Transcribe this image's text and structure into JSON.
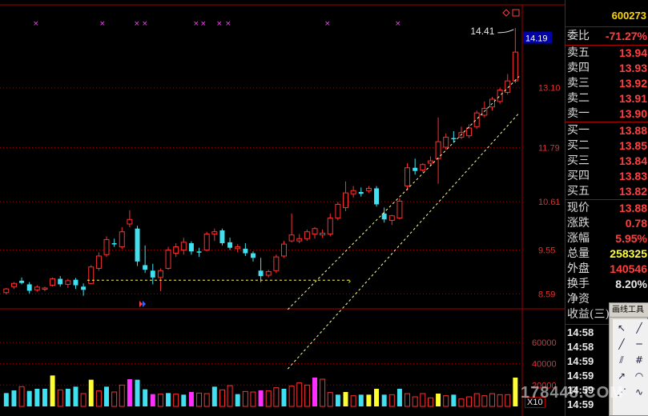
{
  "stock": {
    "code": "600273"
  },
  "price_axis": {
    "labels": [
      "14.19",
      "13.10",
      "11.79",
      "10.61",
      "9.55",
      "8.59"
    ],
    "current": "14.19"
  },
  "volume_axis": {
    "labels": [
      "60000",
      "40000",
      "20000"
    ],
    "multiplier": "X10"
  },
  "annotations": {
    "high_label": "14.41"
  },
  "quote": {
    "weibi": {
      "label": "委比",
      "value": "-71.27%"
    },
    "asks": [
      {
        "label": "卖五",
        "price": "13.94"
      },
      {
        "label": "卖四",
        "price": "13.93"
      },
      {
        "label": "卖三",
        "price": "13.92"
      },
      {
        "label": "卖二",
        "price": "13.91"
      },
      {
        "label": "卖一",
        "price": "13.90"
      }
    ],
    "bids": [
      {
        "label": "买一",
        "price": "13.88"
      },
      {
        "label": "买二",
        "price": "13.85"
      },
      {
        "label": "买三",
        "price": "13.84"
      },
      {
        "label": "买四",
        "price": "13.83"
      },
      {
        "label": "买五",
        "price": "13.82"
      }
    ],
    "stats": [
      {
        "label": "现价",
        "value": "13.88"
      },
      {
        "label": "涨跌",
        "value": "0.78"
      },
      {
        "label": "涨幅",
        "value": "5.95%"
      },
      {
        "label": "总量",
        "value": "258325"
      },
      {
        "label": "外盘",
        "value": "140546"
      },
      {
        "label": "换手",
        "value": "8.20%"
      },
      {
        "label": "净资",
        "value": ""
      },
      {
        "label": "收益(三)",
        "value": ""
      }
    ],
    "ticks": [
      "14:58",
      "14:58",
      "14:59",
      "14:59",
      "14:59",
      "14:59"
    ]
  },
  "drawing_tools": {
    "title": "画线工具"
  },
  "watermark": "178448.COM",
  "colors": {
    "up": "#ff3030",
    "down": "#40e0f0",
    "yellow": "#ffff30",
    "magenta": "#ff30ff",
    "grid": "#a00000"
  },
  "chart_data": {
    "type": "candlestick",
    "title": "",
    "ylim": [
      8.3,
      14.6
    ],
    "candles": [
      {
        "o": 8.62,
        "h": 8.72,
        "l": 8.58,
        "c": 8.7
      },
      {
        "o": 8.75,
        "h": 8.85,
        "l": 8.7,
        "c": 8.82
      },
      {
        "o": 8.88,
        "h": 8.95,
        "l": 8.8,
        "c": 8.83
      },
      {
        "o": 8.8,
        "h": 8.85,
        "l": 8.6,
        "c": 8.66
      },
      {
        "o": 8.68,
        "h": 8.78,
        "l": 8.64,
        "c": 8.74
      },
      {
        "o": 8.7,
        "h": 8.75,
        "l": 8.65,
        "c": 8.72
      },
      {
        "o": 8.78,
        "h": 8.95,
        "l": 8.75,
        "c": 8.92
      },
      {
        "o": 8.92,
        "h": 8.98,
        "l": 8.75,
        "c": 8.8
      },
      {
        "o": 8.8,
        "h": 8.92,
        "l": 8.72,
        "c": 8.88
      },
      {
        "o": 8.9,
        "h": 8.94,
        "l": 8.7,
        "c": 8.78
      },
      {
        "o": 8.75,
        "h": 8.82,
        "l": 8.55,
        "c": 8.68
      },
      {
        "o": 8.82,
        "h": 9.22,
        "l": 8.8,
        "c": 9.18
      },
      {
        "o": 9.15,
        "h": 9.5,
        "l": 9.1,
        "c": 9.42
      },
      {
        "o": 9.45,
        "h": 9.85,
        "l": 9.4,
        "c": 9.78
      },
      {
        "o": 9.7,
        "h": 9.8,
        "l": 9.62,
        "c": 9.68
      },
      {
        "o": 9.62,
        "h": 10.05,
        "l": 9.58,
        "c": 9.95
      },
      {
        "o": 10.12,
        "h": 10.42,
        "l": 10.05,
        "c": 10.22
      },
      {
        "o": 10.02,
        "h": 10.08,
        "l": 9.2,
        "c": 9.3
      },
      {
        "o": 9.22,
        "h": 9.65,
        "l": 9.05,
        "c": 9.12
      },
      {
        "o": 9.1,
        "h": 9.25,
        "l": 8.8,
        "c": 8.95
      },
      {
        "o": 8.95,
        "h": 9.15,
        "l": 8.65,
        "c": 9.1
      },
      {
        "o": 9.15,
        "h": 9.62,
        "l": 9.12,
        "c": 9.55
      },
      {
        "o": 9.48,
        "h": 9.7,
        "l": 9.4,
        "c": 9.62
      },
      {
        "o": 9.55,
        "h": 9.82,
        "l": 9.45,
        "c": 9.72
      },
      {
        "o": 9.7,
        "h": 9.74,
        "l": 9.45,
        "c": 9.52
      },
      {
        "o": 9.52,
        "h": 9.6,
        "l": 9.4,
        "c": 9.5
      },
      {
        "o": 9.55,
        "h": 9.95,
        "l": 9.52,
        "c": 9.9
      },
      {
        "o": 9.9,
        "h": 10.02,
        "l": 9.75,
        "c": 9.95
      },
      {
        "o": 9.98,
        "h": 10.02,
        "l": 9.65,
        "c": 9.7
      },
      {
        "o": 9.72,
        "h": 9.82,
        "l": 9.55,
        "c": 9.6
      },
      {
        "o": 9.58,
        "h": 9.68,
        "l": 9.5,
        "c": 9.62
      },
      {
        "o": 9.58,
        "h": 9.7,
        "l": 9.42,
        "c": 9.48
      },
      {
        "o": 9.48,
        "h": 9.52,
        "l": 9.3,
        "c": 9.38
      },
      {
        "o": 9.1,
        "h": 9.38,
        "l": 8.85,
        "c": 8.98
      },
      {
        "o": 9.0,
        "h": 9.12,
        "l": 8.95,
        "c": 9.08
      },
      {
        "o": 9.1,
        "h": 9.45,
        "l": 9.05,
        "c": 9.4
      },
      {
        "o": 9.42,
        "h": 9.75,
        "l": 9.38,
        "c": 9.68
      },
      {
        "o": 9.75,
        "h": 10.35,
        "l": 9.72,
        "c": 9.88
      },
      {
        "o": 9.75,
        "h": 9.9,
        "l": 9.7,
        "c": 9.8
      },
      {
        "o": 9.8,
        "h": 10.0,
        "l": 9.75,
        "c": 9.95
      },
      {
        "o": 9.9,
        "h": 10.05,
        "l": 9.8,
        "c": 10.02
      },
      {
        "o": 9.88,
        "h": 10.0,
        "l": 9.82,
        "c": 9.92
      },
      {
        "o": 9.9,
        "h": 10.35,
        "l": 9.85,
        "c": 10.25
      },
      {
        "o": 10.25,
        "h": 10.6,
        "l": 10.2,
        "c": 10.55
      },
      {
        "o": 10.48,
        "h": 11.05,
        "l": 10.4,
        "c": 10.8
      },
      {
        "o": 10.78,
        "h": 10.95,
        "l": 10.7,
        "c": 10.85
      },
      {
        "o": 10.82,
        "h": 10.92,
        "l": 10.72,
        "c": 10.78
      },
      {
        "o": 10.85,
        "h": 10.95,
        "l": 10.8,
        "c": 10.9
      },
      {
        "o": 10.9,
        "h": 10.95,
        "l": 10.5,
        "c": 10.55
      },
      {
        "o": 10.35,
        "h": 10.48,
        "l": 10.15,
        "c": 10.22
      },
      {
        "o": 10.2,
        "h": 10.32,
        "l": 10.1,
        "c": 10.3
      },
      {
        "o": 10.25,
        "h": 10.68,
        "l": 10.22,
        "c": 10.62
      },
      {
        "o": 10.95,
        "h": 11.45,
        "l": 10.85,
        "c": 11.35
      },
      {
        "o": 11.35,
        "h": 11.55,
        "l": 11.2,
        "c": 11.28
      },
      {
        "o": 11.3,
        "h": 11.45,
        "l": 11.25,
        "c": 11.42
      },
      {
        "o": 11.45,
        "h": 11.6,
        "l": 11.4,
        "c": 11.5
      },
      {
        "o": 11.55,
        "h": 12.45,
        "l": 11.0,
        "c": 11.92
      },
      {
        "o": 11.8,
        "h": 12.1,
        "l": 11.75,
        "c": 12.02
      },
      {
        "o": 12.0,
        "h": 12.15,
        "l": 11.9,
        "c": 11.98
      },
      {
        "o": 12.02,
        "h": 12.25,
        "l": 11.98,
        "c": 12.12
      },
      {
        "o": 12.05,
        "h": 12.3,
        "l": 12.0,
        "c": 12.22
      },
      {
        "o": 12.25,
        "h": 12.6,
        "l": 12.2,
        "c": 12.55
      },
      {
        "o": 12.5,
        "h": 12.8,
        "l": 12.45,
        "c": 12.65
      },
      {
        "o": 12.68,
        "h": 12.9,
        "l": 12.6,
        "c": 12.85
      },
      {
        "o": 12.8,
        "h": 13.1,
        "l": 12.75,
        "c": 13.05
      },
      {
        "o": 13.0,
        "h": 13.4,
        "l": 12.95,
        "c": 13.25
      },
      {
        "o": 13.25,
        "h": 14.41,
        "l": 13.2,
        "c": 13.88
      }
    ],
    "volumes": [
      {
        "v": 12500,
        "c": "down"
      },
      {
        "v": 15000,
        "c": "down"
      },
      {
        "v": 18500,
        "c": "up"
      },
      {
        "v": 14500,
        "c": "down"
      },
      {
        "v": 16500,
        "c": "down"
      },
      {
        "v": 16500,
        "c": "down"
      },
      {
        "v": 29000,
        "c": "yellow"
      },
      {
        "v": 15500,
        "c": "up"
      },
      {
        "v": 16500,
        "c": "down"
      },
      {
        "v": 18500,
        "c": "down"
      },
      {
        "v": 12000,
        "c": "up"
      },
      {
        "v": 25000,
        "c": "yellow"
      },
      {
        "v": 14500,
        "c": "up"
      },
      {
        "v": 18500,
        "c": "down"
      },
      {
        "v": 13500,
        "c": "up"
      },
      {
        "v": 20000,
        "c": "up"
      },
      {
        "v": 25500,
        "c": "magenta"
      },
      {
        "v": 25000,
        "c": "down"
      },
      {
        "v": 16000,
        "c": "down"
      },
      {
        "v": 11500,
        "c": "magenta"
      },
      {
        "v": 11500,
        "c": "up"
      },
      {
        "v": 12500,
        "c": "down"
      },
      {
        "v": 11500,
        "c": "up"
      },
      {
        "v": 11000,
        "c": "down"
      },
      {
        "v": 13500,
        "c": "magenta"
      },
      {
        "v": 12500,
        "c": "up"
      },
      {
        "v": 12000,
        "c": "up"
      },
      {
        "v": 18500,
        "c": "down"
      },
      {
        "v": 15500,
        "c": "up"
      },
      {
        "v": 19500,
        "c": "up"
      },
      {
        "v": 11500,
        "c": "down"
      },
      {
        "v": 14000,
        "c": "up"
      },
      {
        "v": 13500,
        "c": "up"
      },
      {
        "v": 15000,
        "c": "magenta"
      },
      {
        "v": 14500,
        "c": "up"
      },
      {
        "v": 17500,
        "c": "up"
      },
      {
        "v": 16500,
        "c": "down"
      },
      {
        "v": 19000,
        "c": "up"
      },
      {
        "v": 22000,
        "c": "up"
      },
      {
        "v": 20000,
        "c": "up"
      },
      {
        "v": 27000,
        "c": "magenta"
      },
      {
        "v": 25500,
        "c": "up"
      },
      {
        "v": 13000,
        "c": "up"
      },
      {
        "v": 11000,
        "c": "down"
      },
      {
        "v": 13500,
        "c": "yellow"
      },
      {
        "v": 10000,
        "c": "up"
      },
      {
        "v": 11000,
        "c": "down"
      },
      {
        "v": 11000,
        "c": "yellow"
      },
      {
        "v": 16500,
        "c": "yellow"
      },
      {
        "v": 11000,
        "c": "down"
      },
      {
        "v": 11000,
        "c": "up"
      },
      {
        "v": 16500,
        "c": "down"
      },
      {
        "v": 12000,
        "c": "up"
      },
      {
        "v": 9000,
        "c": "up"
      },
      {
        "v": 12000,
        "c": "up"
      },
      {
        "v": 8000,
        "c": "up"
      },
      {
        "v": 12000,
        "c": "yellow"
      },
      {
        "v": 10000,
        "c": "up"
      },
      {
        "v": 11000,
        "c": "down"
      },
      {
        "v": 7000,
        "c": "up"
      },
      {
        "v": 9000,
        "c": "up"
      },
      {
        "v": 12000,
        "c": "up"
      },
      {
        "v": 10000,
        "c": "up"
      },
      {
        "v": 12000,
        "c": "up"
      },
      {
        "v": 11000,
        "c": "up"
      },
      {
        "v": 11000,
        "c": "up"
      },
      {
        "v": 27000,
        "c": "yellow"
      }
    ],
    "vlim": [
      0,
      75000
    ],
    "dashed_horizontal": 8.89,
    "trend_channel": [
      [
        9.6,
        13.0
      ],
      [
        8.3,
        12.2
      ]
    ]
  }
}
